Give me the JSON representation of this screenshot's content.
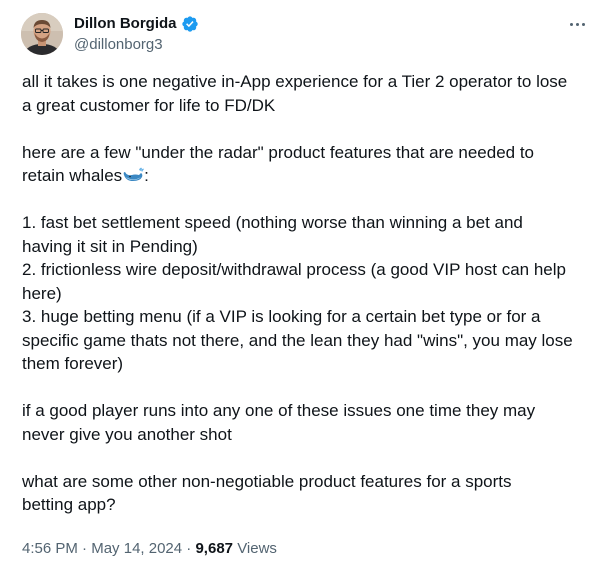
{
  "author": {
    "display_name": "Dillon Borgida",
    "handle": "@dillonborg3",
    "verified_badge_color": "#1d9bf0",
    "verified_icon": "verified-badge-icon"
  },
  "tweet": {
    "paragraphs": [
      [
        "all it takes is one negative in-App experience for a Tier 2 operator to lose",
        "a great customer for life to FD/DK"
      ],
      [
        "here are a few \"under the radar\" product features that are needed to",
        "retain whales",
        ":"
      ],
      [
        "1. fast bet settlement speed (nothing worse than winning a bet and",
        "having it sit in Pending)",
        "2. frictionless wire deposit/withdrawal process (a good VIP host can help",
        "here)",
        "3. huge betting menu (if a VIP is looking for a certain bet type or for a",
        "specific game thats not there, and the lean they had \"wins\", you may lose",
        "them forever)"
      ],
      [
        "if a good player runs into any one of these issues one time they may",
        "never give you another shot"
      ],
      [
        "what are some other non-negotiable product features for a sports",
        "betting app?"
      ]
    ],
    "emoji": "whale-emoji"
  },
  "meta": {
    "time": "4:56 PM",
    "separator": "·",
    "date": "May 14, 2024",
    "views_count": "9,687",
    "views_label": "Views"
  },
  "icons": {
    "more": "more-options-icon"
  }
}
